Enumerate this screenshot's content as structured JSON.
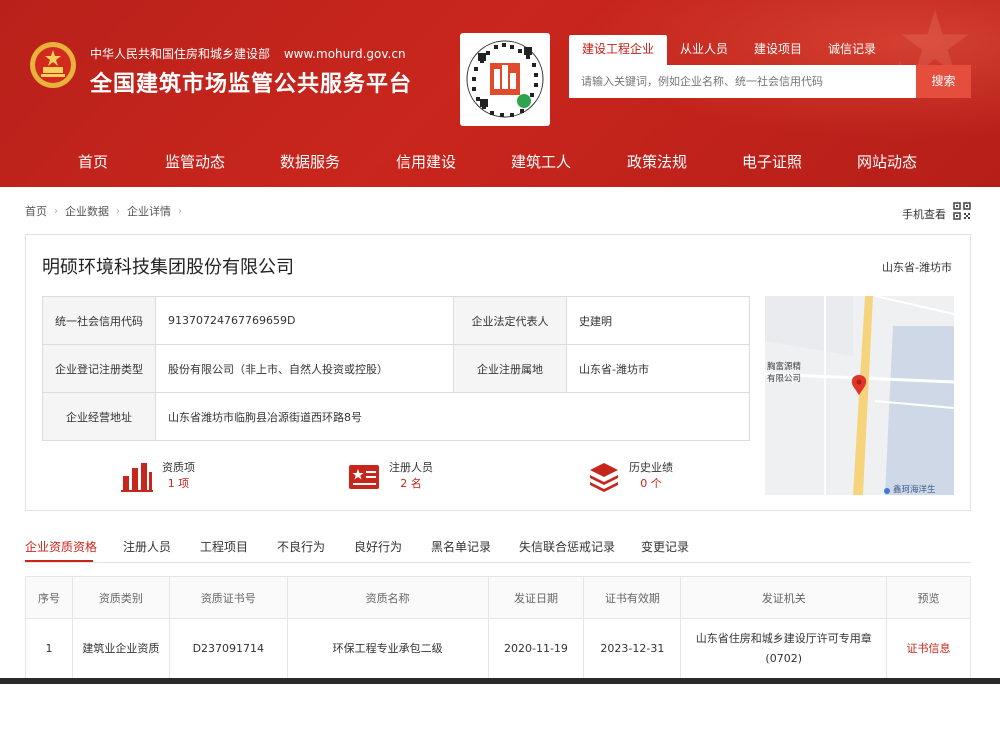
{
  "header": {
    "ministry": "中华人民共和国住房和城乡建设部",
    "url": "www.mohurd.gov.cn",
    "platform_title": "全国建筑市场监管公共服务平台",
    "search_tabs": [
      {
        "label": "建设工程企业",
        "active": true
      },
      {
        "label": "从业人员",
        "active": false
      },
      {
        "label": "建设项目",
        "active": false
      },
      {
        "label": "诚信记录",
        "active": false
      }
    ],
    "search_placeholder": "请输入关键词，例如企业名称、统一社会信用代码",
    "search_button": "搜索",
    "nav": [
      "首页",
      "监管动态",
      "数据服务",
      "信用建设",
      "建筑工人",
      "政策法规",
      "电子证照",
      "网站动态"
    ]
  },
  "breadcrumb": [
    "首页",
    "企业数据",
    "企业详情"
  ],
  "mobile_view": "手机查看",
  "company": {
    "name": "明硕环境科技集团股份有限公司",
    "region": "山东省-潍坊市",
    "credit_code_label": "统一社会信用代码",
    "credit_code": "91370724767769659D",
    "legal_rep_label": "企业法定代表人",
    "legal_rep": "史建明",
    "reg_type_label": "企业登记注册类型",
    "reg_type": "股份有限公司（非上市、自然人投资或控股）",
    "reg_place_label": "企业注册属地",
    "reg_place": "山东省-潍坊市",
    "address_label": "企业经营地址",
    "address": "山东省潍坊市临朐县冶源街道西环路8号"
  },
  "stats": [
    {
      "label": "资质项",
      "value": "1 项"
    },
    {
      "label": "注册人员",
      "value": "2 名"
    },
    {
      "label": "历史业绩",
      "value": "0 个"
    }
  ],
  "map": {
    "poi_label_1": "胸富源精",
    "poi_label_2": "有限公司",
    "poi_bottom": "鑫珂海洋生"
  },
  "tabs": [
    "企业资质资格",
    "注册人员",
    "工程项目",
    "不良行为",
    "良好行为",
    "黑名单记录",
    "失信联合惩戒记录",
    "变更记录"
  ],
  "qual_table": {
    "headers": [
      "序号",
      "资质类别",
      "资质证书号",
      "资质名称",
      "发证日期",
      "证书有效期",
      "发证机关",
      "预览"
    ],
    "rows": [
      {
        "no": "1",
        "category": "建筑业企业资质",
        "cert_no": "D237091714",
        "name": "环保工程专业承包二级",
        "issue_date": "2020-11-19",
        "valid_until": "2023-12-31",
        "authority_line1": "山东省住房和城乡建设厅许可专用章",
        "authority_line2": "(0702)",
        "preview": "证书信息"
      }
    ]
  },
  "colors": {
    "header_red": "#c21f17",
    "accent_red": "#c7261c",
    "search_button": "#e54d3d"
  }
}
